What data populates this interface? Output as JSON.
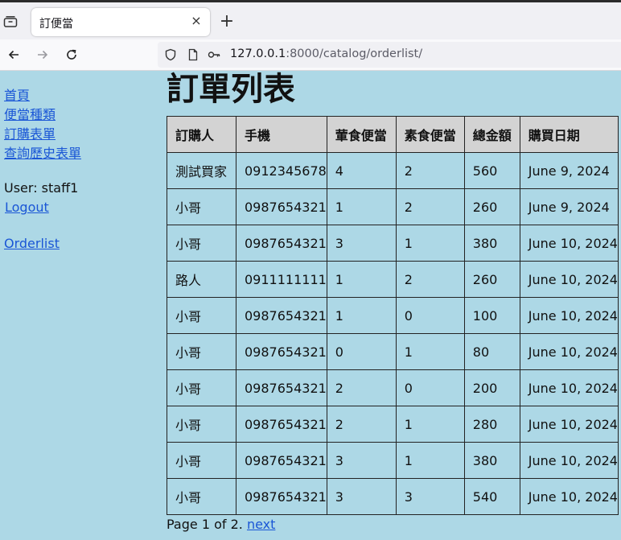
{
  "browser": {
    "tab_title": "訂便當",
    "tab_close_icon": "×",
    "new_tab_icon": "+",
    "url_host": "127.0.0.1",
    "url_rest": ":8000/catalog/orderlist/"
  },
  "sidebar": {
    "links": [
      {
        "label": "首頁"
      },
      {
        "label": "便當種類"
      },
      {
        "label": "訂購表單"
      },
      {
        "label": "查詢歷史表單"
      }
    ],
    "user_label": "User: staff1",
    "logout": "Logout",
    "orderlist": "Orderlist"
  },
  "page": {
    "title": "訂單列表"
  },
  "table": {
    "headers": [
      "訂購人",
      "手機",
      "葷食便當",
      "素食便當",
      "總金額",
      "購買日期"
    ],
    "rows": [
      [
        "測試買家",
        "0912345678",
        "4",
        "2",
        "560",
        "June 9, 2024"
      ],
      [
        "小哥",
        "0987654321",
        "1",
        "2",
        "260",
        "June 9, 2024"
      ],
      [
        "小哥",
        "0987654321",
        "3",
        "1",
        "380",
        "June 10, 2024"
      ],
      [
        "路人",
        "0911111111",
        "1",
        "2",
        "260",
        "June 10, 2024"
      ],
      [
        "小哥",
        "0987654321",
        "1",
        "0",
        "100",
        "June 10, 2024"
      ],
      [
        "小哥",
        "0987654321",
        "0",
        "1",
        "80",
        "June 10, 2024"
      ],
      [
        "小哥",
        "0987654321",
        "2",
        "0",
        "200",
        "June 10, 2024"
      ],
      [
        "小哥",
        "0987654321",
        "2",
        "1",
        "280",
        "June 10, 2024"
      ],
      [
        "小哥",
        "0987654321",
        "3",
        "1",
        "380",
        "June 10, 2024"
      ],
      [
        "小哥",
        "0987654321",
        "3",
        "3",
        "540",
        "June 10, 2024"
      ]
    ]
  },
  "pagination": {
    "text": "Page 1 of 2.",
    "next": "next"
  },
  "colors": {
    "background": "#add8e6",
    "header_bg": "#d3d3d3",
    "link": "#1a56d6"
  }
}
